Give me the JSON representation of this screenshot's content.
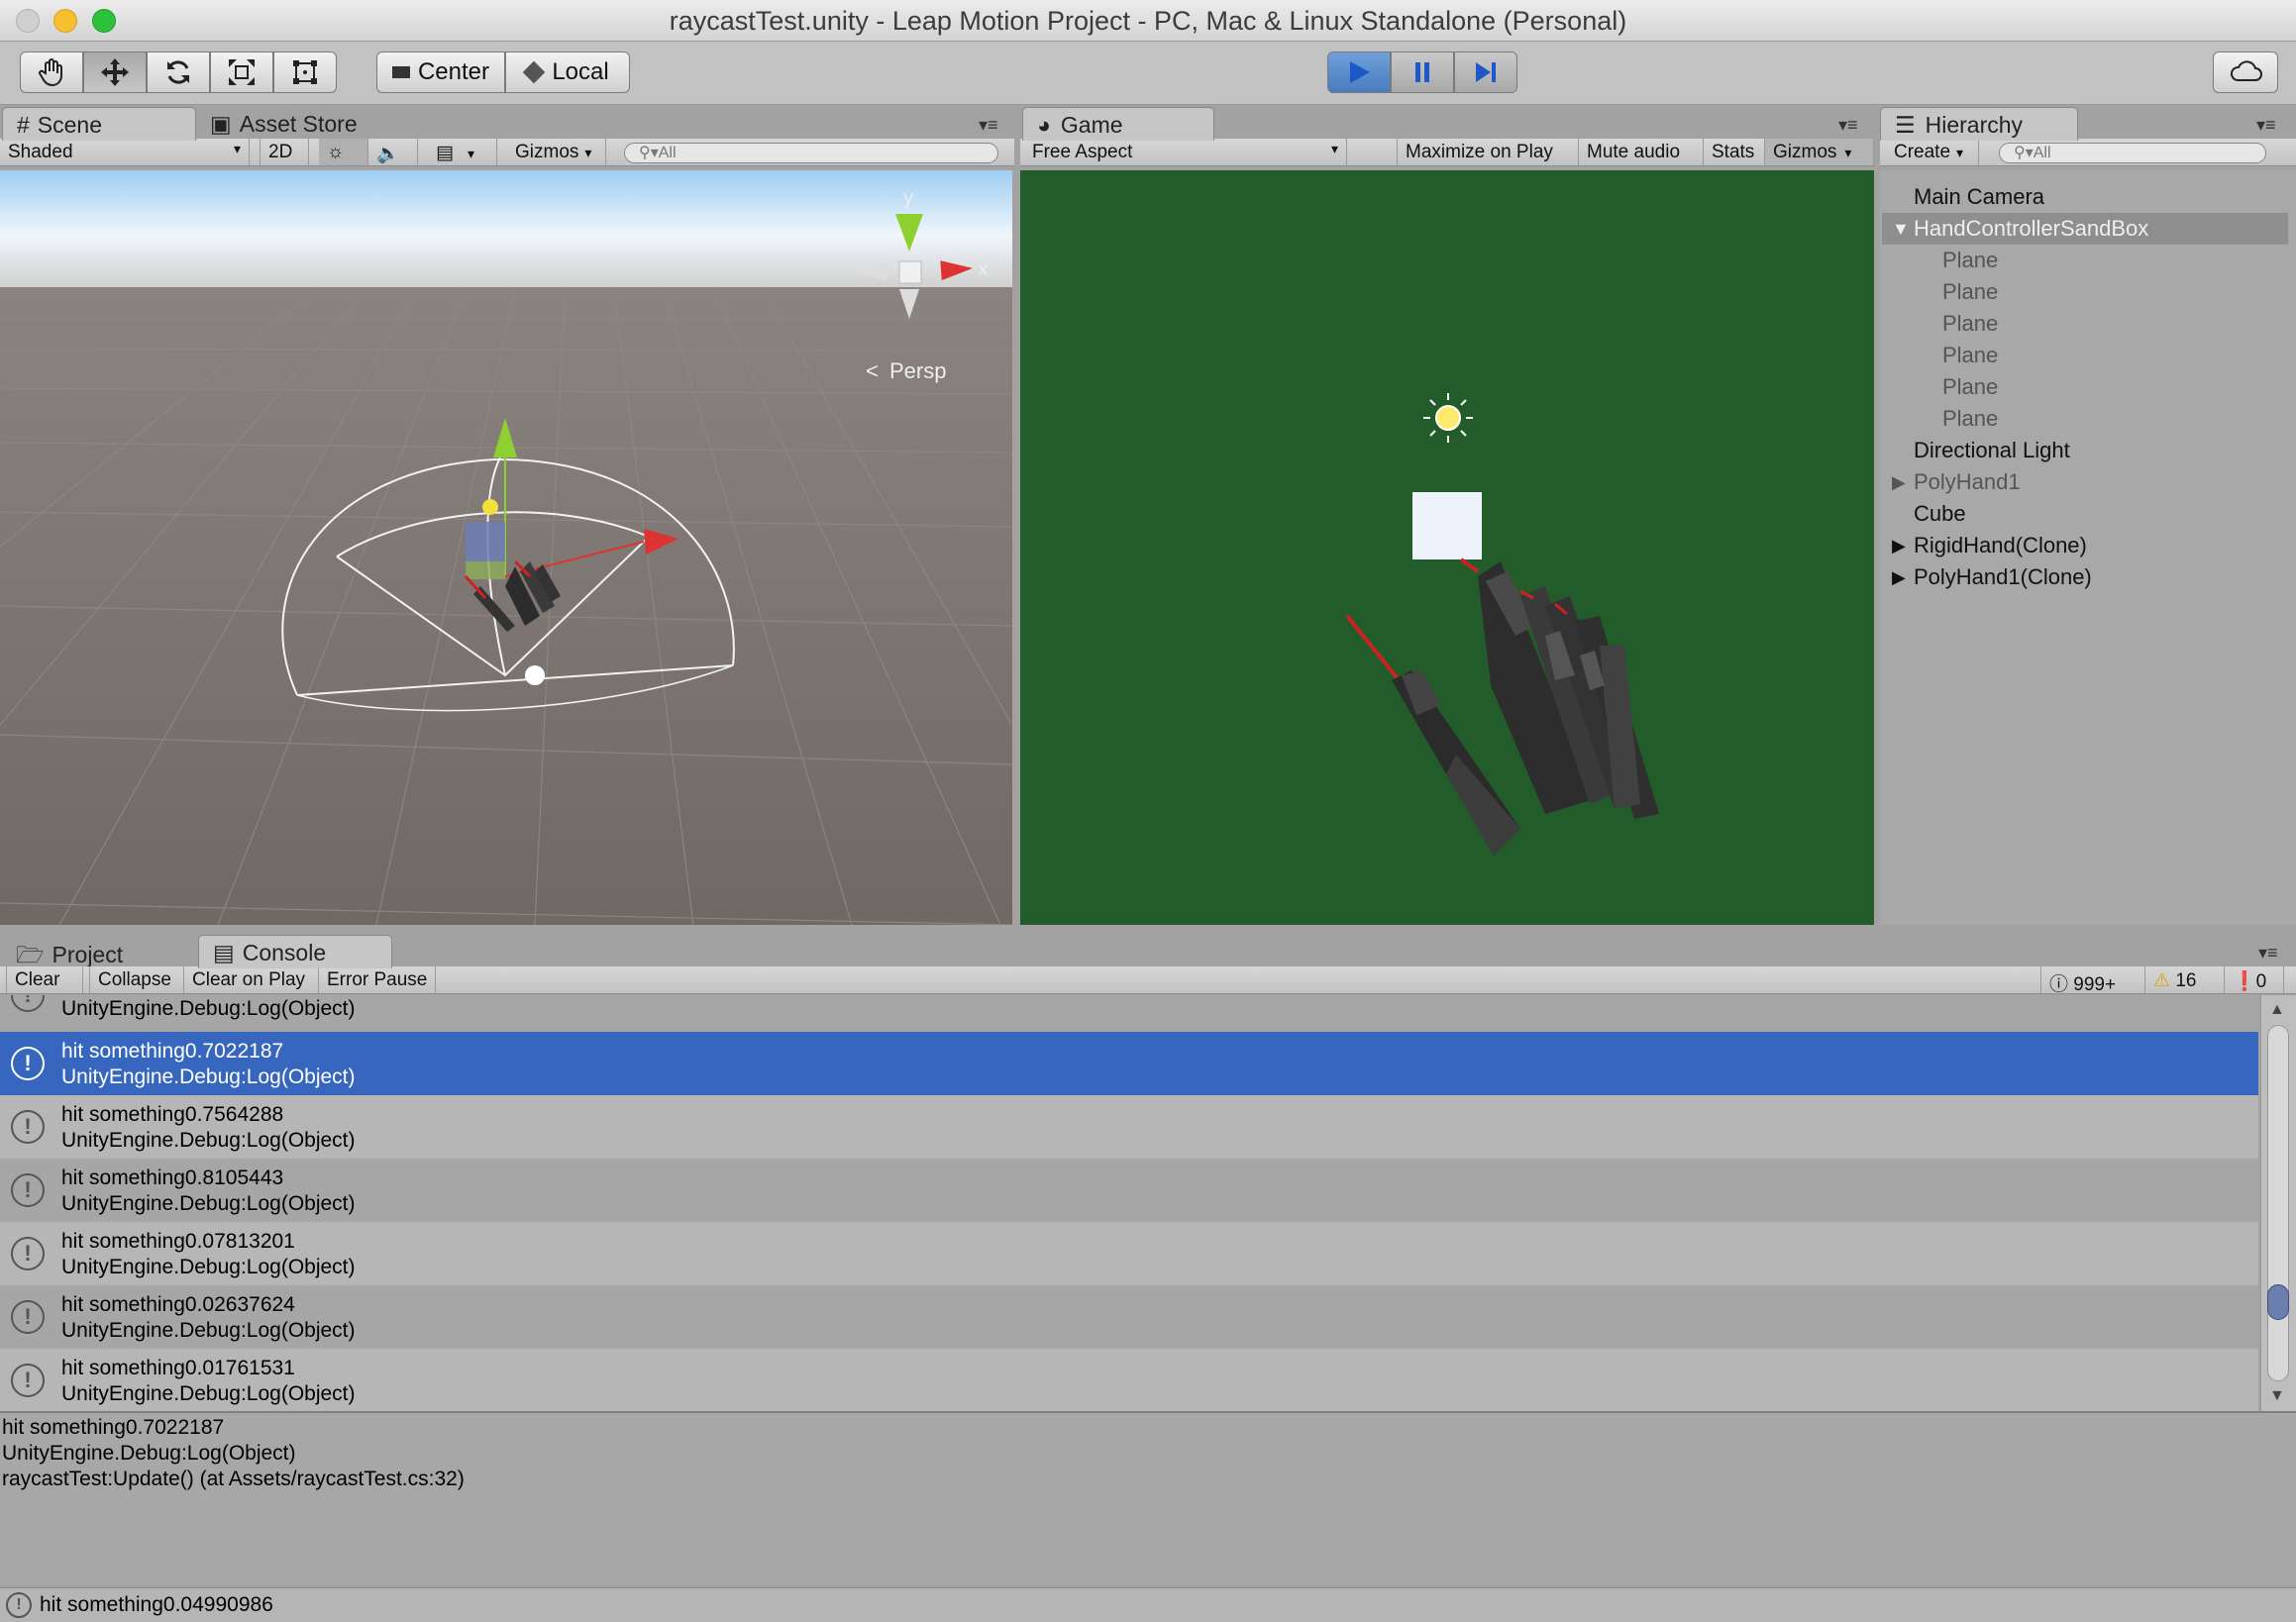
{
  "window": {
    "title": "raycastTest.unity - Leap Motion Project - PC, Mac & Linux Standalone (Personal)"
  },
  "toolbar": {
    "tools": [
      "hand-tool",
      "move-tool",
      "rotate-tool",
      "scale-tool",
      "rect-tool"
    ],
    "pivot_label": "Center",
    "space_label": "Local",
    "play_state": "playing"
  },
  "scene": {
    "tab_label": "Scene",
    "asset_store_label": "Asset Store",
    "shading": "Shaded",
    "mode_2d": "2D",
    "gizmos": "Gizmos",
    "search_placeholder": "All",
    "gizmo_axis_y": "y",
    "gizmo_axis_x": "x",
    "persp_label": "Persp"
  },
  "game": {
    "tab_label": "Game",
    "aspect": "Free Aspect",
    "maximize": "Maximize on Play",
    "mute": "Mute audio",
    "stats": "Stats",
    "gizmos": "Gizmos",
    "background_color": "#225c2a"
  },
  "hierarchy": {
    "tab_label": "Hierarchy",
    "create": "Create",
    "search_placeholder": "All",
    "items": [
      {
        "label": "Main Camera"
      },
      {
        "label": "HandControllerSandBox"
      },
      {
        "label": "Plane"
      },
      {
        "label": "Plane"
      },
      {
        "label": "Plane"
      },
      {
        "label": "Plane"
      },
      {
        "label": "Plane"
      },
      {
        "label": "Plane"
      },
      {
        "label": "Directional Light"
      },
      {
        "label": "PolyHand1"
      },
      {
        "label": "Cube"
      },
      {
        "label": "RigidHand(Clone)"
      },
      {
        "label": "PolyHand1(Clone)"
      }
    ]
  },
  "console": {
    "project_tab": "Project",
    "console_tab": "Console",
    "buttons": {
      "clear": "Clear",
      "collapse": "Collapse",
      "clear_on_play": "Clear on Play",
      "error_pause": "Error Pause"
    },
    "counts": {
      "logs": "999+",
      "warnings": "16",
      "errors": "0"
    },
    "partial_row": "UnityEngine.Debug:Log(Object)",
    "rows": [
      {
        "msg": "hit something0.7022187",
        "src": "UnityEngine.Debug:Log(Object)"
      },
      {
        "msg": "hit something0.7564288",
        "src": "UnityEngine.Debug:Log(Object)"
      },
      {
        "msg": "hit something0.8105443",
        "src": "UnityEngine.Debug:Log(Object)"
      },
      {
        "msg": "hit something0.07813201",
        "src": "UnityEngine.Debug:Log(Object)"
      },
      {
        "msg": "hit something0.02637624",
        "src": "UnityEngine.Debug:Log(Object)"
      },
      {
        "msg": "hit something0.01761531",
        "src": "UnityEngine.Debug:Log(Object)"
      }
    ],
    "detail": [
      "hit something0.7022187",
      "UnityEngine.Debug:Log(Object)",
      "raycastTest:Update() (at Assets/raycastTest.cs:32)"
    ]
  },
  "statusbar": {
    "text": "hit something0.04990986"
  }
}
